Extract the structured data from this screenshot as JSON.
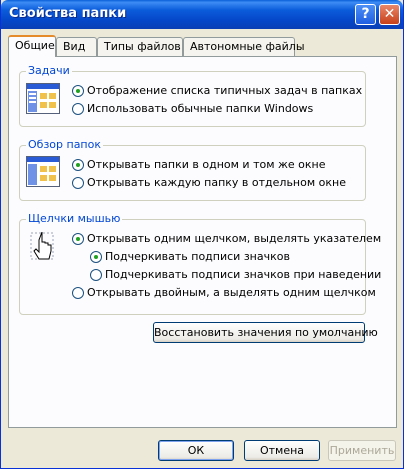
{
  "window": {
    "title": "Свойства папки"
  },
  "titlebar_buttons": {
    "help": "?",
    "close": "✕"
  },
  "tabs": [
    {
      "label": "Общие",
      "active": true
    },
    {
      "label": "Вид",
      "active": false
    },
    {
      "label": "Типы файлов",
      "active": false
    },
    {
      "label": "Автономные файлы",
      "active": false
    }
  ],
  "tasks": {
    "label": "Задачи",
    "options": [
      {
        "label": "Отображение списка типичных задач в папках",
        "selected": true
      },
      {
        "label": "Использовать обычные папки Windows",
        "selected": false
      }
    ]
  },
  "browse": {
    "label": "Обзор папок",
    "options": [
      {
        "label": "Открывать папки в одном и том же окне",
        "selected": true
      },
      {
        "label": "Открывать каждую папку в отдельном окне",
        "selected": false
      }
    ]
  },
  "clicks": {
    "label": "Щелчки мышью",
    "options": [
      {
        "label": "Открывать одним щелчком, выделять указателем",
        "selected": true
      },
      {
        "label": "Подчеркивать подписи значков",
        "selected": true
      },
      {
        "label": "Подчеркивать подписи значков при наведении",
        "selected": false
      },
      {
        "label": "Открывать двойным, а выделять одним щелчком",
        "selected": false
      }
    ]
  },
  "restore_defaults": "Восстановить значения по умолчанию",
  "footer": {
    "ok": "ОК",
    "cancel": "Отмена",
    "apply": "Применить"
  }
}
